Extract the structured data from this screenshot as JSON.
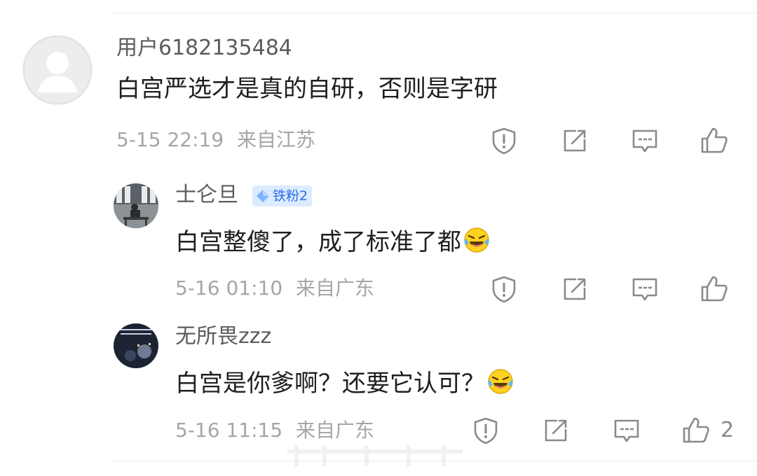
{
  "comments": [
    {
      "username": "用户6182135484",
      "text": "白宫严选才是真的自研，否则是字研",
      "time": "5-15 22:19",
      "location": "来自江苏"
    },
    {
      "username": "士仑旦",
      "badge": "铁粉2",
      "text": "白宫整傻了，成了标准了都",
      "time": "5-16 01:10",
      "location": "来自广东"
    },
    {
      "username": "无所畏zzz",
      "text": "白宫是你爹啊？还要它认可？",
      "time": "5-16 11:15",
      "location": "来自广东",
      "like_count": "2"
    }
  ],
  "icons": {
    "report": "shield-alert-icon",
    "share": "share-icon",
    "reply": "comment-icon",
    "like": "thumbs-up-icon",
    "emoji": "laughing-tears-emoji"
  },
  "colors": {
    "username": "#5c5c5c",
    "text": "#1f1f1f",
    "meta": "#a6a6a6",
    "icon": "#8a8a8a",
    "badge_bg": "#dcebff",
    "badge_text": "#2b6de4"
  }
}
